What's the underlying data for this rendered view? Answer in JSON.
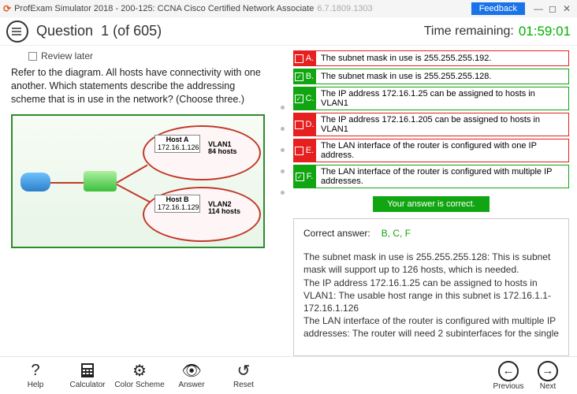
{
  "titlebar": {
    "app": "ProfExam Simulator 2018",
    "exam": "200-125: CCNA Cisco Certified Network Associate",
    "version": "6.7.1809.1303",
    "feedback": "Feedback"
  },
  "header": {
    "question_label": "Question",
    "question_num": "1",
    "question_of": "(of 605)",
    "time_label": "Time remaining:",
    "time_value": "01:59:01"
  },
  "review_label": "Review later",
  "question_text": "Refer to the diagram. All hosts have connectivity with one another. Which statements describe the addressing scheme that is in use in the network? (Choose three.)",
  "diagram": {
    "hostA_label": "Host A",
    "hostA_ip": "172.16.1.126",
    "hostB_label": "Host B",
    "hostB_ip": "172.16.1.129",
    "vlan1_name": "VLAN1",
    "vlan1_hosts": "84 hosts",
    "vlan2_name": "VLAN2",
    "vlan2_hosts": "114 hosts"
  },
  "options": [
    {
      "letter": "A.",
      "text": "The subnet mask in use is 255.255.255.192.",
      "color": "red",
      "checked": false
    },
    {
      "letter": "B.",
      "text": "The subnet mask in use is 255.255.255.128.",
      "color": "green",
      "checked": true
    },
    {
      "letter": "C.",
      "text": "The IP address 172.16.1.25 can be assigned to hosts in VLAN1",
      "color": "green",
      "checked": true
    },
    {
      "letter": "D.",
      "text": "The IP address 172.16.1.205 can be assigned to hosts in VLAN1",
      "color": "red",
      "checked": false
    },
    {
      "letter": "E.",
      "text": "The LAN interface of the router is configured with one IP address.",
      "color": "red",
      "checked": false
    },
    {
      "letter": "F.",
      "text": "The LAN interface of the router is configured with multiple IP addresses.",
      "color": "green",
      "checked": true
    }
  ],
  "result_banner": "Your answer is correct.",
  "correct_label": "Correct answer:",
  "correct_value": "B, C, F",
  "explanation": "The subnet mask in use is 255.255.255.128: This is subnet mask will support up to 126 hosts, which is needed.\nThe IP address 172.16.1.25 can be assigned to hosts in VLAN1: The usable host range in this subnet is 172.16.1.1-172.16.1.126\nThe LAN interface of the router is configured with multiple IP addresses: The router will need 2 subinterfaces for the single",
  "footer": {
    "help": "Help",
    "calc": "Calculator",
    "color": "Color Scheme",
    "answer": "Answer",
    "reset": "Reset",
    "prev": "Previous",
    "next": "Next"
  }
}
